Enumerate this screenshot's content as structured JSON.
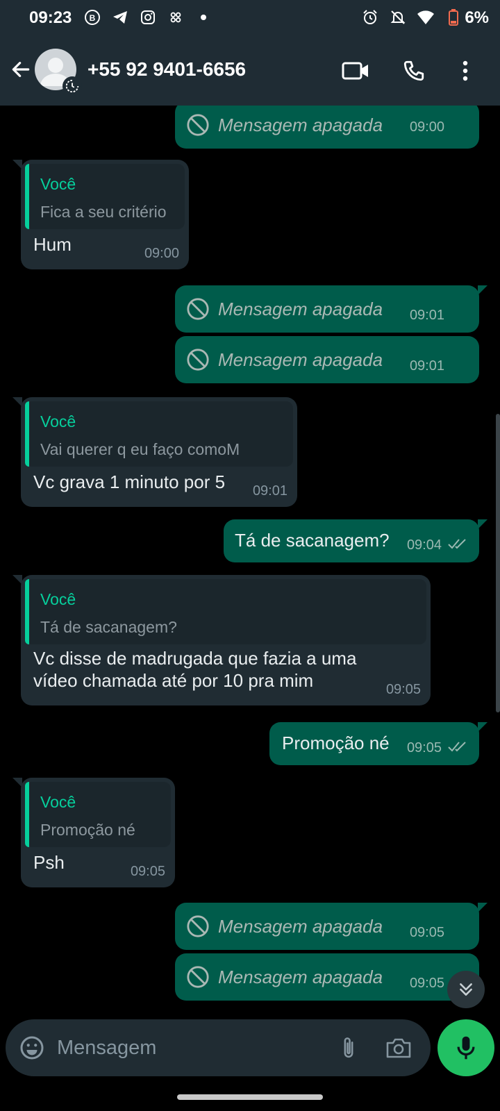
{
  "status_bar": {
    "time": "09:23",
    "battery": "6%"
  },
  "header": {
    "contact": "+55 92 9401-6656"
  },
  "messages": [
    {
      "dir": "out",
      "deleted": true,
      "text": "Mensagem apagada",
      "time": "09:00"
    },
    {
      "dir": "in",
      "quote_author": "Você",
      "quote_text": "Fica a seu critério",
      "text": "Hum",
      "time": "09:00"
    },
    {
      "dir": "out",
      "deleted": true,
      "text": "Mensagem apagada",
      "time": "09:01"
    },
    {
      "dir": "out",
      "deleted": true,
      "text": "Mensagem apagada",
      "time": "09:01"
    },
    {
      "dir": "in",
      "quote_author": "Você",
      "quote_text": "Vai querer q eu faço comoM",
      "text": "Vc grava 1 minuto por 5",
      "time": "09:01"
    },
    {
      "dir": "out",
      "text": "Tá de sacanagem?",
      "time": "09:04",
      "status": "read"
    },
    {
      "dir": "in",
      "quote_author": "Você",
      "quote_text": "Tá de sacanagem?",
      "text_lines": [
        "Vc disse de madrugada que fazia a uma",
        "vídeo chamada até por 10 pra mim"
      ],
      "time": "09:05"
    },
    {
      "dir": "out",
      "text": "Promoção né",
      "time": "09:05",
      "status": "read"
    },
    {
      "dir": "in",
      "quote_author": "Você",
      "quote_text": "Promoção né",
      "text": "Psh",
      "time": "09:05"
    },
    {
      "dir": "out",
      "deleted": true,
      "text": "Mensagem apagada",
      "time": "09:05"
    },
    {
      "dir": "out",
      "deleted": true,
      "text": "Mensagem apagada",
      "time": "09:05"
    }
  ],
  "composer": {
    "placeholder": "Mensagem"
  },
  "colors": {
    "header_bg": "#1f2c34",
    "outgoing_bubble": "#005c4b",
    "incoming_bubble": "#202c33",
    "accent": "#06cf9c",
    "mic_button": "#21c063"
  }
}
